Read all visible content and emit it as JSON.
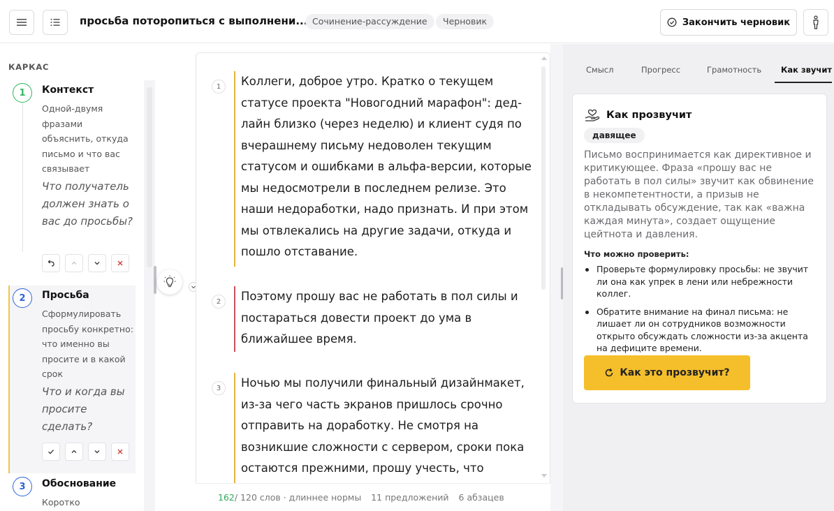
{
  "header": {
    "doc_title": "просьба потoропиться с выполнени...",
    "genre_chip": "Сочинение-рассуждение",
    "status_chip": "Черновик",
    "finish_button": "Закончить черновик"
  },
  "skeleton": {
    "title": "КАРКАС",
    "steps": [
      {
        "num": "1",
        "title": "Контекст",
        "desc": "Одной-двумя фразами объяснить, откуда письмо и что вас связывает",
        "question": "Что получатель должен знать о вас до просьбы?",
        "color": "#2fb862"
      },
      {
        "num": "2",
        "title": "Просьба",
        "desc": "Сформулировать просьбу конкретно: что именно вы просите и в какой срок",
        "question": "Что и когда вы просите сделать?",
        "color": "#2f63d8"
      },
      {
        "num": "3",
        "title": "Обоснование",
        "desc": "Коротко объяснить, почему",
        "color": "#2f63d8"
      }
    ]
  },
  "editor": {
    "paragraphs": [
      {
        "num": "1",
        "text": "Коллеги, доброе утро. Кратко о текущем статусе проекта \"Новогодний марафон\": дед-лайн близко (через неделю) и клиент судя по вчерашнему письму недоволен текущим статусом и ошибками в альфа-версии, которые мы недосмотрели в последнем релизе. Это наши недоработки, надо признать. И при этом мы отвлекались на другие задачи, откуда и пошло отставание.",
        "bar_color": "#e3b341"
      },
      {
        "num": "2",
        "text": "Поэтому прошу вас не работать в пол силы и постараться довести проект до ума в ближайшее время.",
        "bar_color": "#c8515b"
      },
      {
        "num": "3",
        "text": "Ночью мы получили финальный дизайнмакет, из-за чего часть экранов пришлось срочно отправить на доработку. Не смотря на возникшие сложности с сервером, сроки пока остаются прежними, прошу учесть, что",
        "bar_color": "#e3b341"
      }
    ],
    "stats": {
      "word_count": "162",
      "word_limit": " / 120 слов · длиннее нормы",
      "sentences": "11 предложений",
      "paragraphs": "6 абзацев"
    }
  },
  "panel": {
    "tabs": [
      "Смысл",
      "Прогресс",
      "Грамотность",
      "Как звучит"
    ],
    "active_tab": "Как звучит",
    "card": {
      "title": "Как прозвучит",
      "tone": "давящее",
      "description": "Письмо воспринимается как директивное и критикующее. Фраза «прошу вас не работать в пол силы» звучит как обвинение в некомпетентности, а призыв не откладывать обсуждение, так как «важна каждая минута», создает ощущение цейтнота и давления.",
      "check_title": "Что можно проверить:",
      "checks": [
        "Проверьте формулировку просьбы: не звучит ли она как упрек в лени или небрежности коллег.",
        "Обратите внимание на финал письма: не лишает ли он сотрудников возможности открыто обсуждать сложности из-за акцента на дефиците времени."
      ],
      "cta_label": "Как это прозвучит?"
    }
  },
  "colors": {
    "accent": "#f5be2b",
    "green": "#2fa85a",
    "blue": "#2f63d8"
  }
}
